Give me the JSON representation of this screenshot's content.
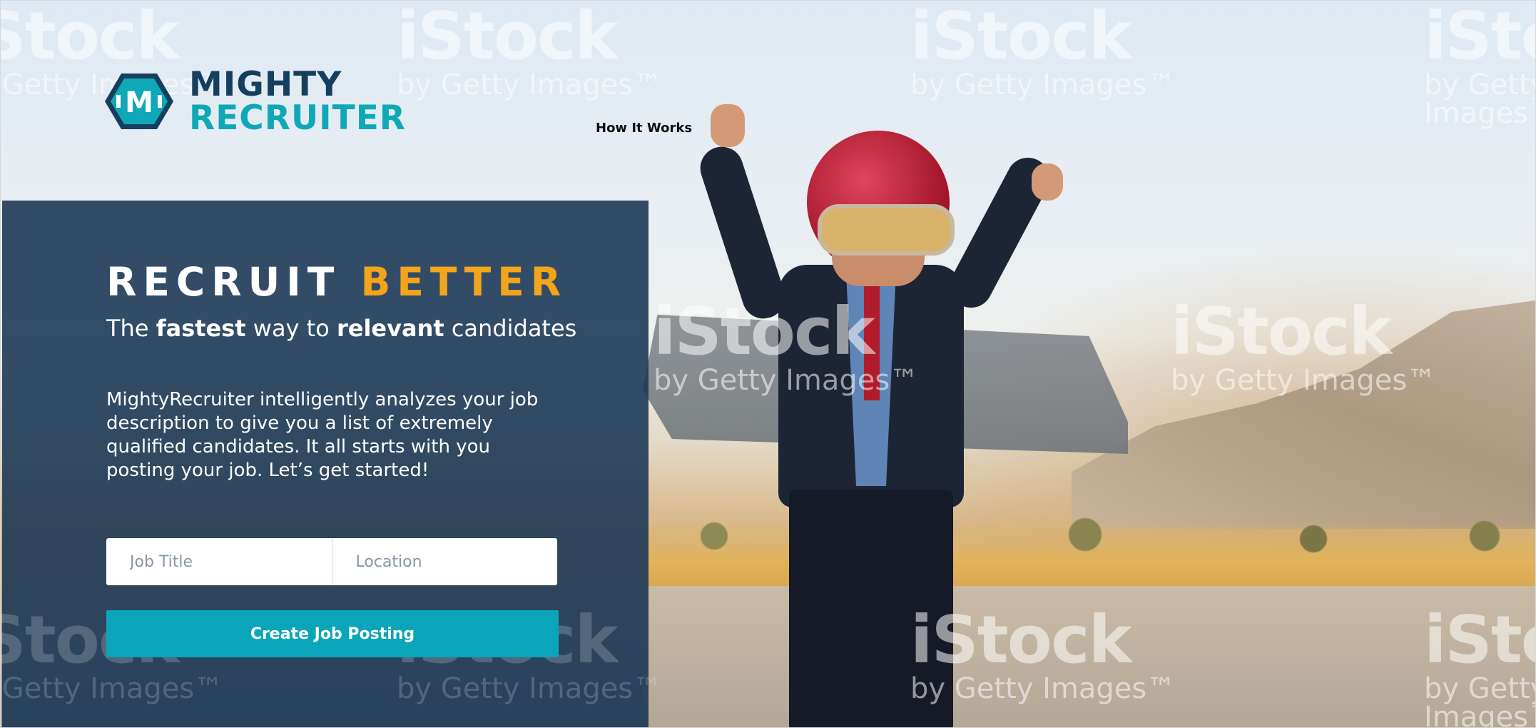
{
  "brand": {
    "name_line1": "MIGHTY",
    "name_line2": "RECRUITER",
    "logo_letter": "M",
    "color_dark": "#153f5e",
    "color_teal": "#10a8b7"
  },
  "nav": {
    "how_it_works": "How It Works"
  },
  "hero": {
    "headline_part1": "RECRUIT",
    "headline_part2": "BETTER",
    "accent_color": "#f2a51a",
    "subhead_pre": "The",
    "subhead_fastest": "fastest",
    "subhead_mid": "way to",
    "subhead_relevant": "relevant",
    "subhead_post": "candidates",
    "description": "MightyRecruiter intelligently analyzes your job description to give you a list of extremely qualified candidates. It all starts with you posting your job. Let’s get started!"
  },
  "form": {
    "job_title_placeholder": "Job Title",
    "job_title_value": "",
    "location_placeholder": "Location",
    "location_value": "",
    "submit_label": "Create Job Posting",
    "submit_color": "#0aa5b8"
  },
  "watermark": {
    "brand": "iStock",
    "tagline": "by Getty Images",
    "tm": "™"
  },
  "background": {
    "icon": "kid-with-jetpack-photo"
  }
}
